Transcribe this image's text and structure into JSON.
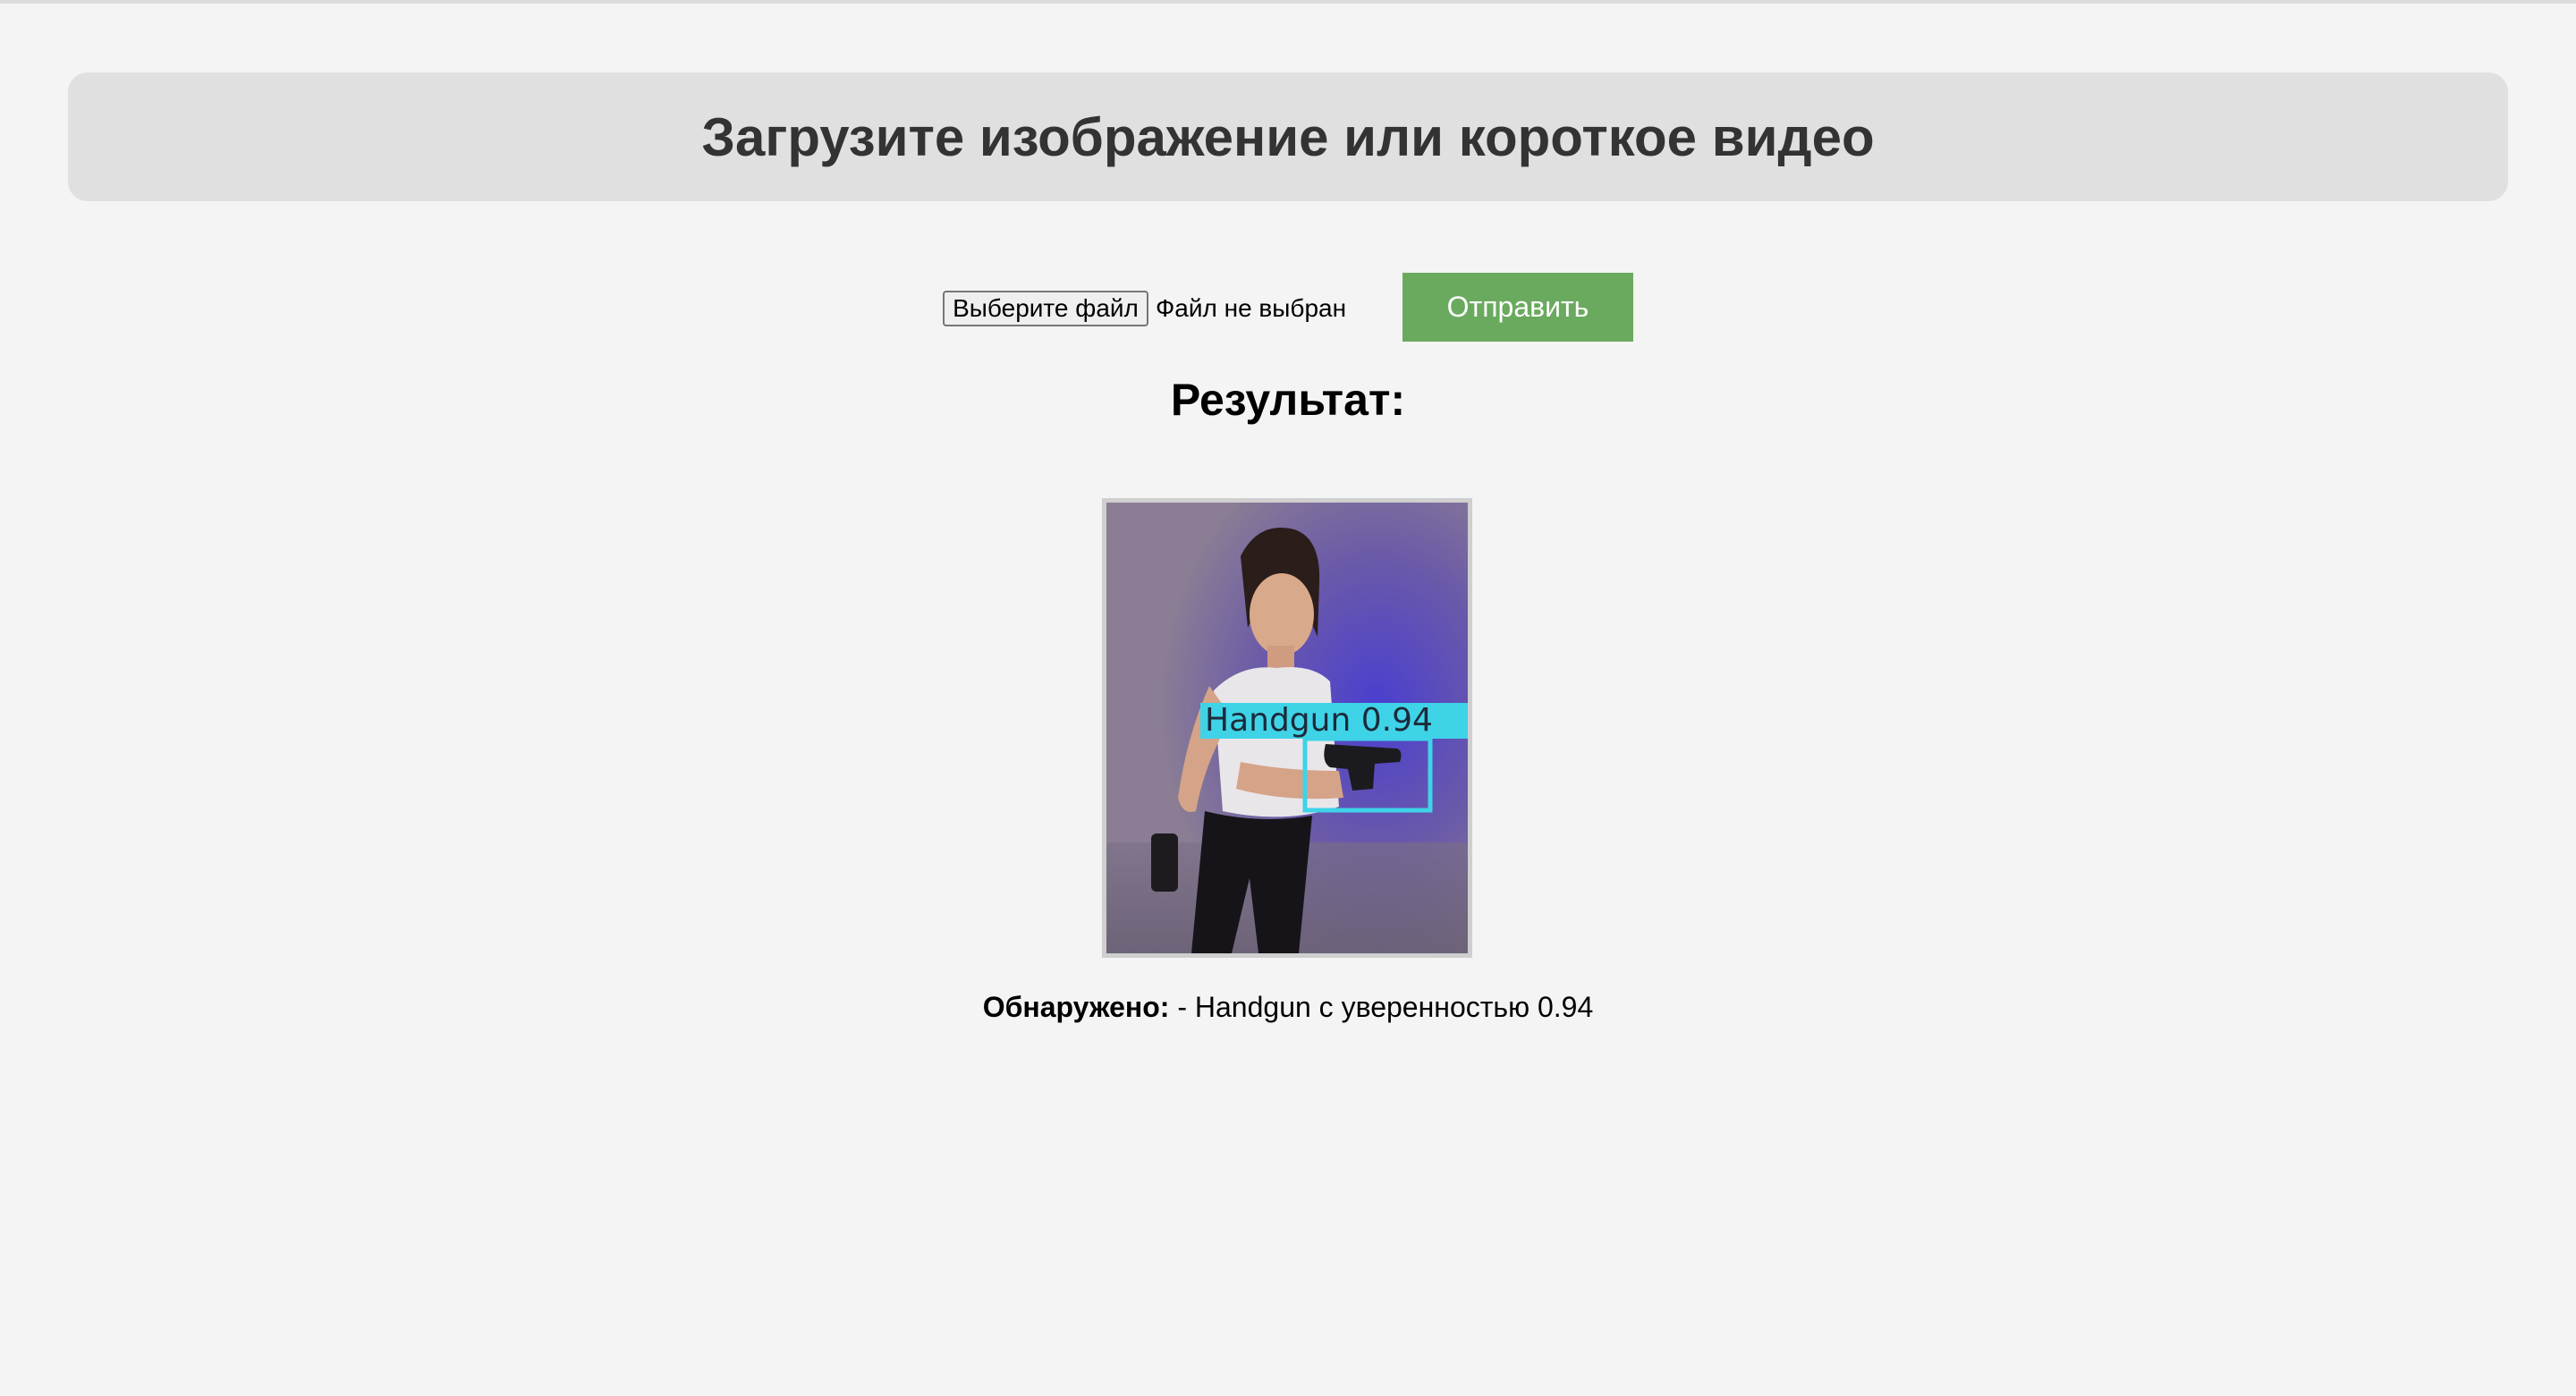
{
  "header": {
    "title": "Загрузите изображение или короткое видео"
  },
  "upload": {
    "choose_file_label": "Выберите файл",
    "file_status": "Файл не выбран",
    "submit_label": "Отправить"
  },
  "result": {
    "title": "Результат:",
    "detection_box_label": "Handgun 0.94",
    "detected_label": "Обнаружено:",
    "detected_text": " - Handgun с уверенностью 0.94"
  },
  "colors": {
    "header_bg": "#e0e0e0",
    "submit_bg": "#6aaa5f",
    "detection_box": "#3fd3e8"
  }
}
